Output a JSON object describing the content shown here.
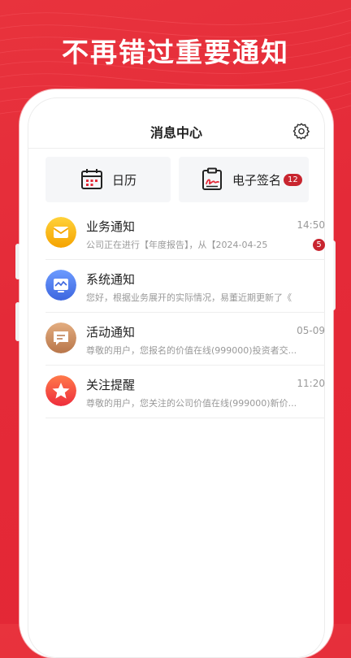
{
  "headline": "不再错过重要通知",
  "nav": {
    "title": "消息中心"
  },
  "quick": {
    "calendar_label": "日历",
    "esign_label": "电子签名",
    "esign_badge": "12"
  },
  "messages": [
    {
      "title": "业务通知",
      "time": "14:50",
      "snippet": "公司正在进行【年度报告】，从【2024-04-25",
      "count": "5"
    },
    {
      "title": "系统通知",
      "time": "",
      "snippet": "您好，根据业务展开的实际情况，易董近期更新了《",
      "count": ""
    },
    {
      "title": "活动通知",
      "time": "05-09",
      "snippet": "尊敬的用户，您报名的价值在线(999000)投资者交...",
      "count": ""
    },
    {
      "title": "关注提醒",
      "time": "11:20",
      "snippet": "尊敬的用户，您关注的公司价值在线(999000)新价...",
      "count": ""
    }
  ],
  "colors": {
    "brand_red": "#e42a38",
    "badge_red": "#c8252f",
    "business_icon": "#f7b500",
    "system_icon": "#4f7be8",
    "activity_icon": "#c98a5a",
    "follow_icon": "#f0483e"
  }
}
